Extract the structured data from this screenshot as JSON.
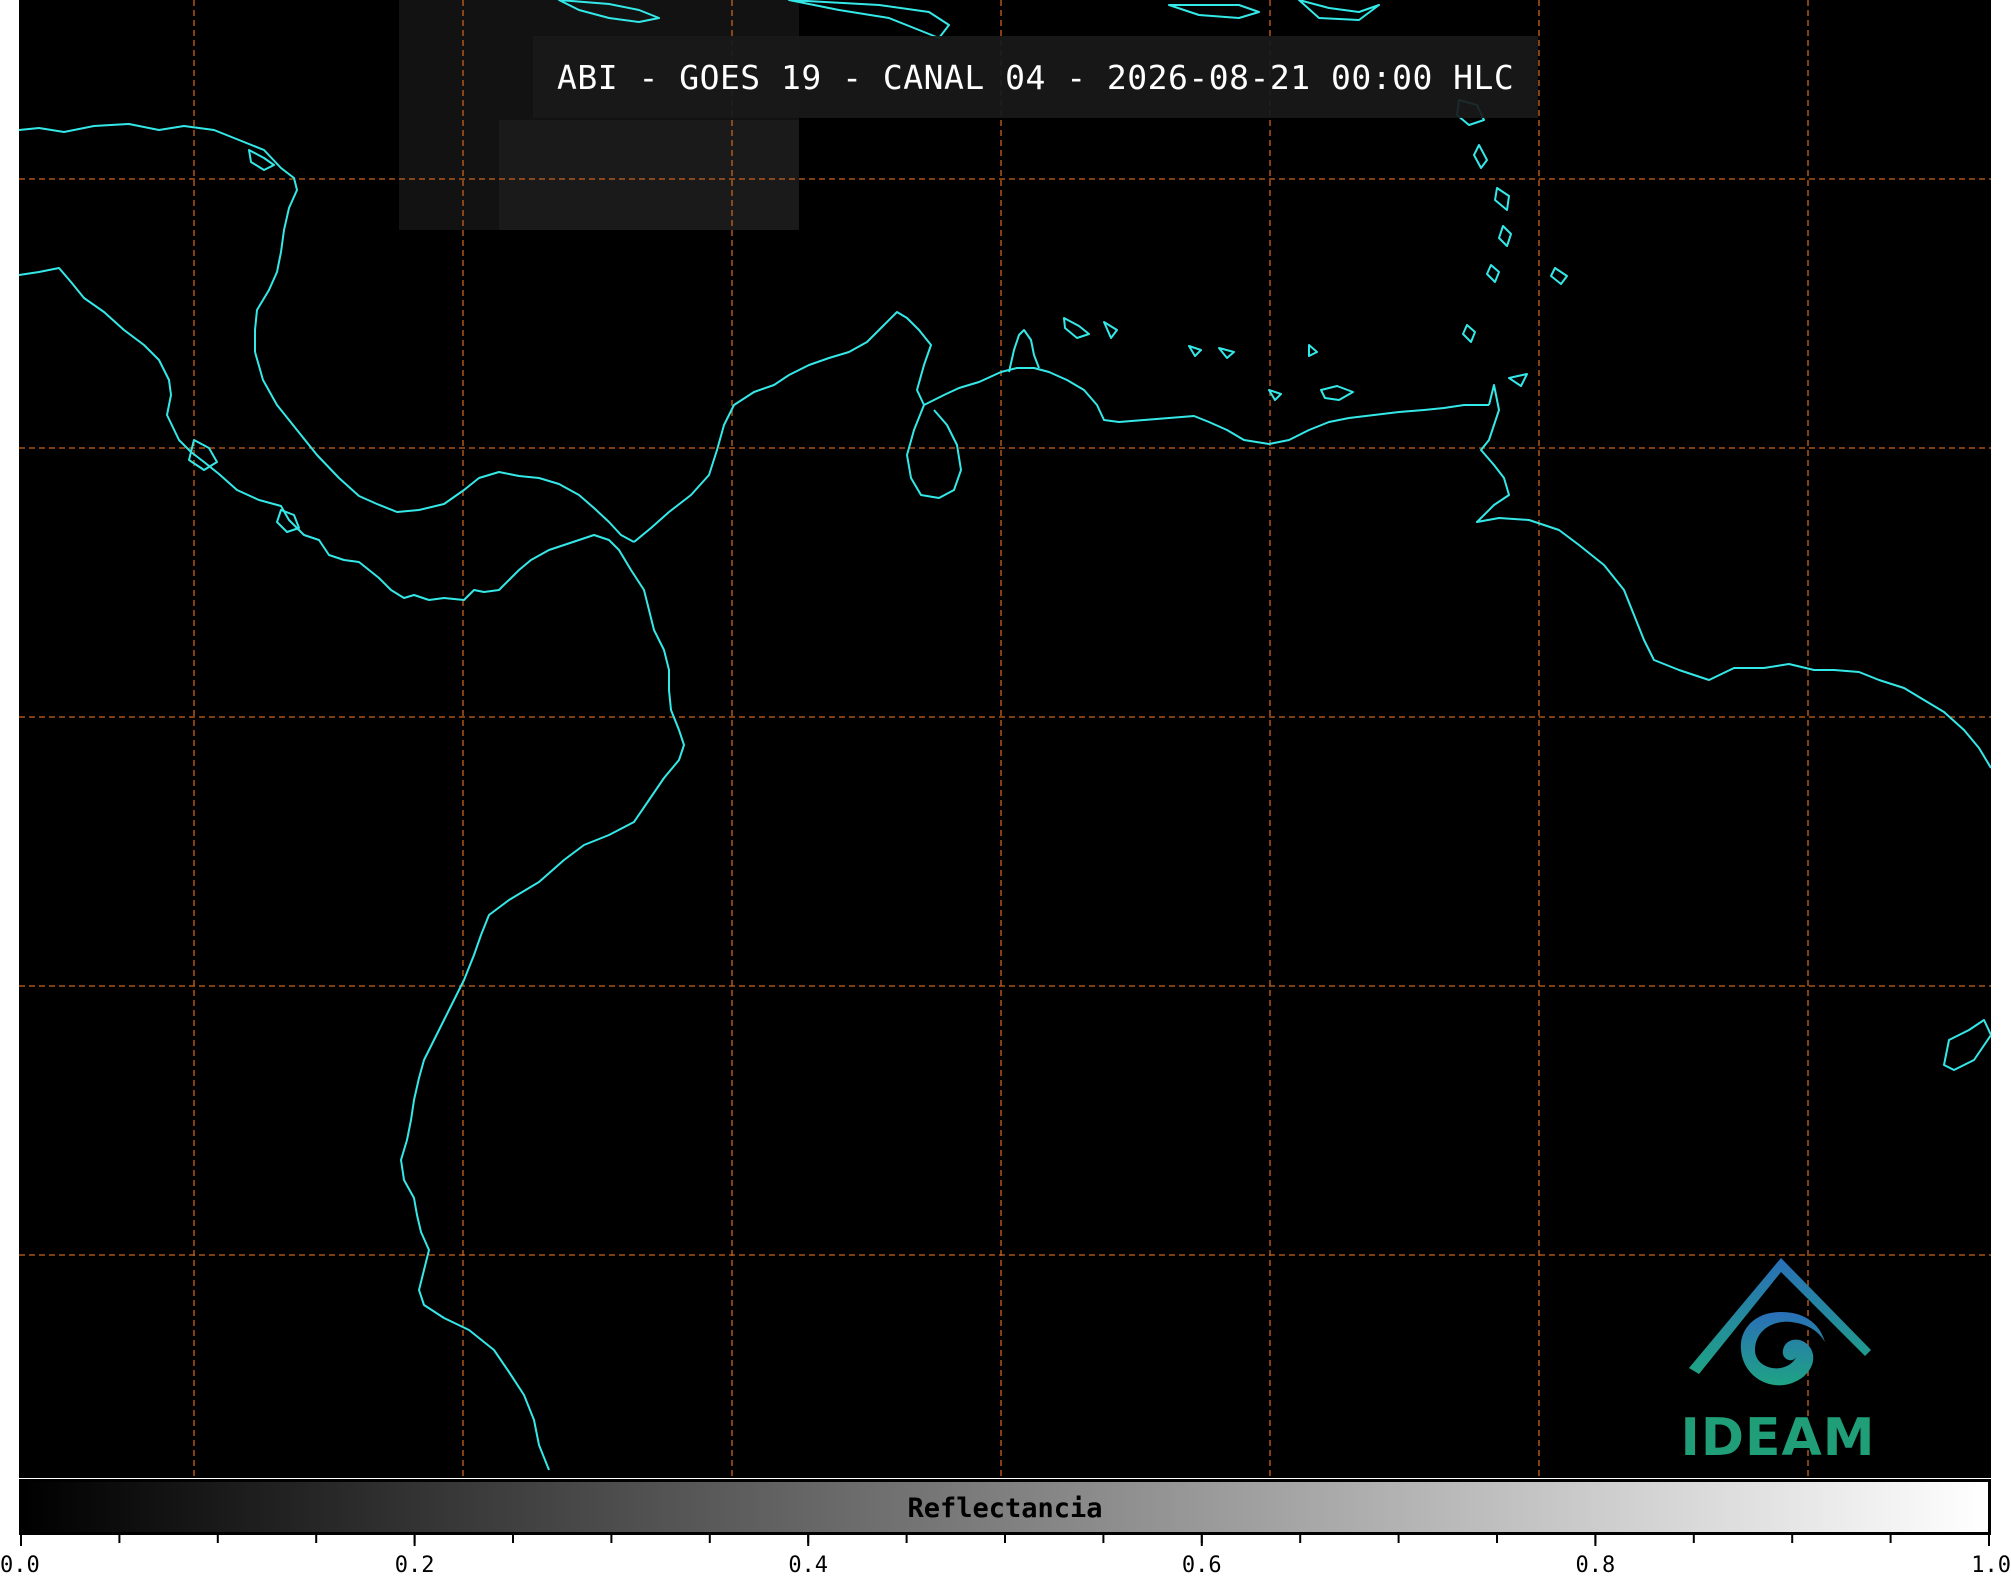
{
  "title": "ABI - GOES 19 - CANAL 04 - 2026-08-21 00:00 HLC",
  "colorbar": {
    "label": "Reflectancia",
    "min": 0.0,
    "max": 1.0,
    "tick_labels": [
      "0.0",
      "0.2",
      "0.4",
      "0.6",
      "0.8",
      "1.0"
    ],
    "minor_tick_step": 0.05,
    "colormap": "grayscale black-to-white"
  },
  "logo": {
    "text": "IDEAM"
  },
  "map": {
    "background": "#000000",
    "coastline_color": "#35e8e8",
    "gridline_color": "#c8641e",
    "gridline_style": "dashed",
    "gridlines": {
      "vertical_count": 7,
      "horizontal_count": 5
    }
  }
}
